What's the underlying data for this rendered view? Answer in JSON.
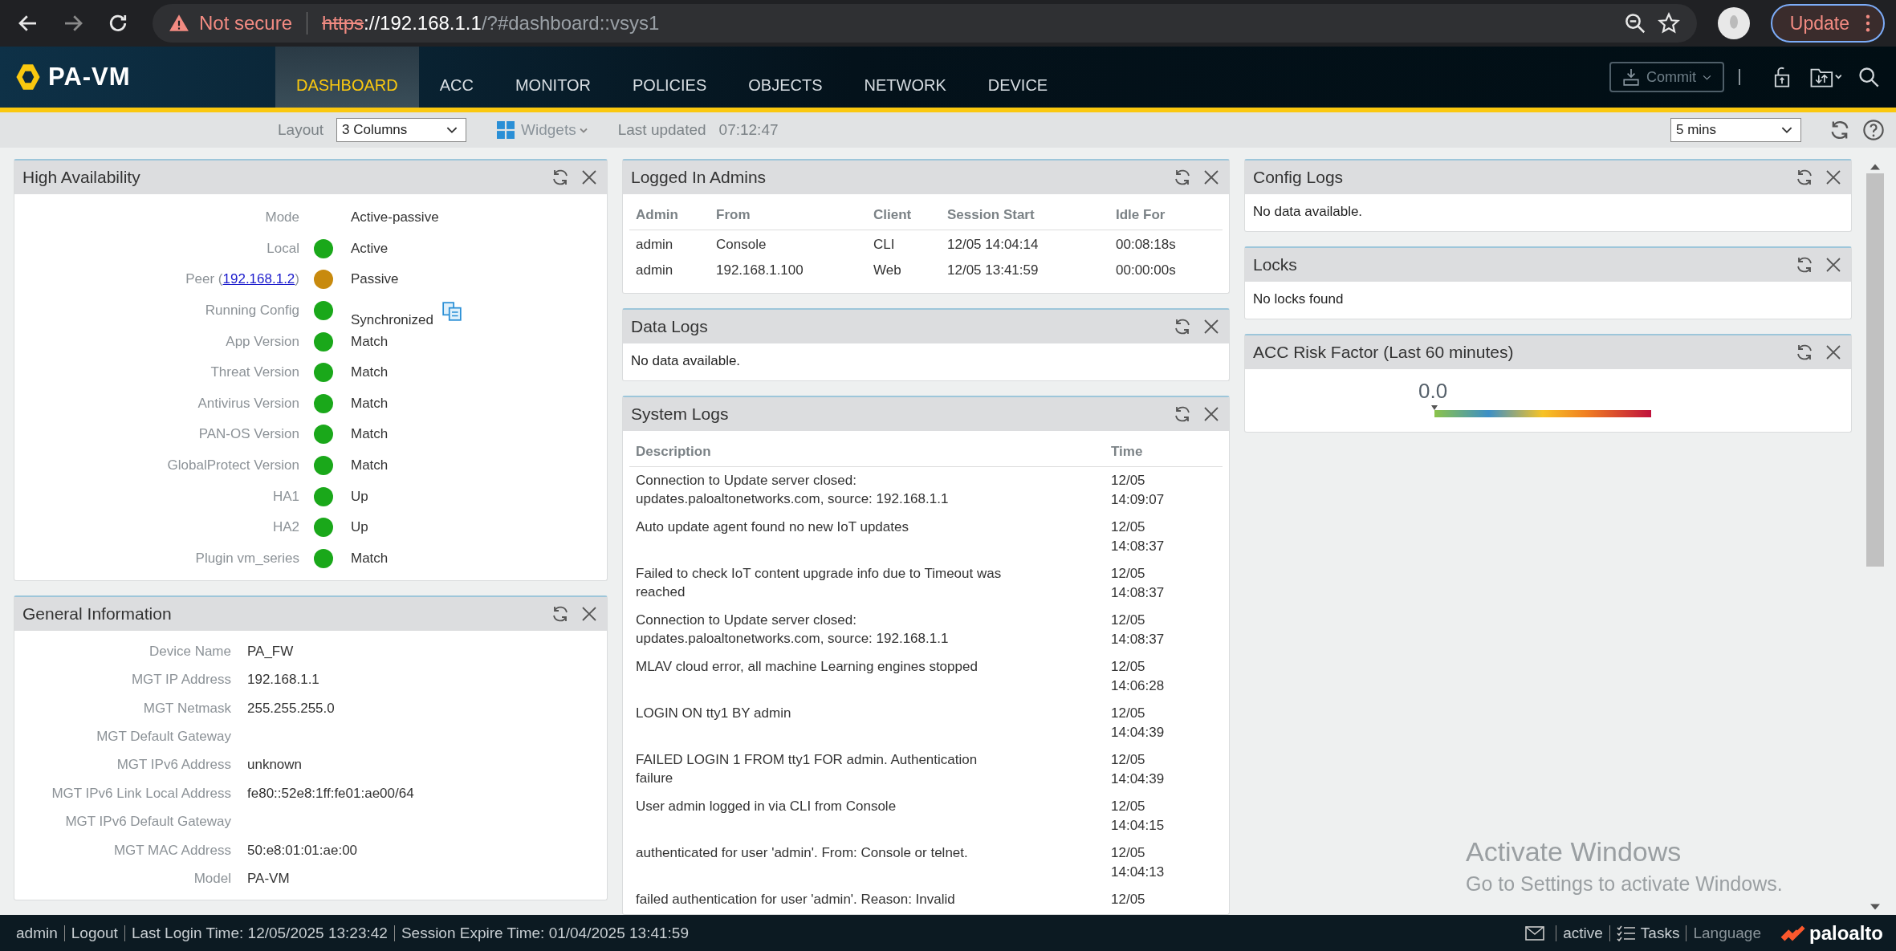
{
  "browser": {
    "security": "Not secure",
    "url_scheme": "https",
    "url_host": "://192.168.1.1",
    "url_path": "/?#dashboard::vsys1",
    "update": "Update"
  },
  "app": {
    "logo": "PA-VM",
    "tabs": [
      {
        "label": "DASHBOARD",
        "selected": true
      },
      {
        "label": "ACC",
        "selected": false
      },
      {
        "label": "MONITOR",
        "selected": false
      },
      {
        "label": "POLICIES",
        "selected": false
      },
      {
        "label": "OBJECTS",
        "selected": false
      },
      {
        "label": "NETWORK",
        "selected": false
      },
      {
        "label": "DEVICE",
        "selected": false
      }
    ],
    "commit": "Commit"
  },
  "toolbar": {
    "layout_label": "Layout",
    "layout_value": "3 Columns",
    "widgets": "Widgets",
    "updated_label": "Last updated",
    "updated_time": "07:12:47",
    "interval": "5 mins"
  },
  "high_availability": {
    "title": "High Availability",
    "rows": [
      {
        "label": "Mode",
        "value": "Active-passive",
        "sync_icon": false
      },
      {
        "label": "Local",
        "color": "#1aa81a",
        "value": "Active",
        "sync_icon": false
      },
      {
        "label": "Peer (",
        "link": "192.168.1.2",
        "label_end": ")",
        "color": "#c88a0e",
        "value": "Passive",
        "sync_icon": false
      },
      {
        "label": "Running Config",
        "color": "#1aa81a",
        "value": "Synchronized",
        "sync_icon": true
      },
      {
        "label": "App Version",
        "color": "#1aa81a",
        "value": "Match",
        "sync_icon": false
      },
      {
        "label": "Threat Version",
        "color": "#1aa81a",
        "value": "Match",
        "sync_icon": false
      },
      {
        "label": "Antivirus Version",
        "color": "#1aa81a",
        "value": "Match",
        "sync_icon": false
      },
      {
        "label": "PAN-OS Version",
        "color": "#1aa81a",
        "value": "Match",
        "sync_icon": false
      },
      {
        "label": "GlobalProtect Version",
        "color": "#1aa81a",
        "value": "Match",
        "sync_icon": false
      },
      {
        "label": "HA1",
        "color": "#1aa81a",
        "value": "Up",
        "sync_icon": false
      },
      {
        "label": "HA2",
        "color": "#1aa81a",
        "value": "Up",
        "sync_icon": false
      },
      {
        "label": "Plugin vm_series",
        "color": "#1aa81a",
        "value": "Match",
        "sync_icon": false
      }
    ]
  },
  "general_information": {
    "title": "General Information",
    "rows": [
      {
        "label": "Device Name",
        "value": "PA_FW"
      },
      {
        "label": "MGT IP Address",
        "value": "192.168.1.1"
      },
      {
        "label": "MGT Netmask",
        "value": "255.255.255.0"
      },
      {
        "label": "MGT Default Gateway"
      },
      {
        "label": "MGT IPv6 Address",
        "value": "unknown"
      },
      {
        "label": "MGT IPv6 Link Local Address",
        "value": "fe80::52e8:1ff:fe01:ae00/64"
      },
      {
        "label": "MGT IPv6 Default Gateway"
      },
      {
        "label": "MGT MAC Address",
        "value": "50:e8:01:01:ae:00"
      },
      {
        "label": "Model",
        "value": "PA-VM"
      }
    ]
  },
  "logged_in_admins": {
    "title": "Logged In Admins",
    "columns": [
      "Admin",
      "From",
      "Client",
      "Session Start",
      "Idle For"
    ],
    "rows": [
      [
        "admin",
        "Console",
        "CLI",
        "12/05 14:04:14",
        "00:08:18s"
      ],
      [
        "admin",
        "192.168.1.100",
        "Web",
        "12/05 13:41:59",
        "00:00:00s"
      ]
    ]
  },
  "data_logs": {
    "title": "Data Logs",
    "message": "No data available."
  },
  "system_logs": {
    "title": "System Logs",
    "columns": [
      "Description",
      "Time"
    ],
    "rows": [
      {
        "description": "Connection to Update server closed: updates.paloaltonetworks.com, source: 192.168.1.1",
        "date": "12/05",
        "time": "14:09:07"
      },
      {
        "description": "Auto update agent found no new IoT updates",
        "date": "12/05",
        "time": "14:08:37"
      },
      {
        "description": "Failed to check IoT content upgrade info due to Timeout was reached",
        "date": "12/05",
        "time": "14:08:37"
      },
      {
        "description": "Connection to Update server closed: updates.paloaltonetworks.com, source: 192.168.1.1",
        "date": "12/05",
        "time": "14:08:37"
      },
      {
        "description": "MLAV cloud error, all machine Learning engines stopped",
        "date": "12/05",
        "time": "14:06:28"
      },
      {
        "description": "LOGIN ON tty1 BY admin",
        "date": "12/05",
        "time": "14:04:39"
      },
      {
        "description": "FAILED LOGIN 1 FROM tty1 FOR admin. Authentication failure",
        "date": "12/05",
        "time": "14:04:39"
      },
      {
        "description": "User admin logged in via CLI from Console",
        "date": "12/05",
        "time": "14:04:15"
      },
      {
        "description": "authenticated for user 'admin'. From: Console or telnet.",
        "date": "12/05",
        "time": "14:04:13"
      },
      {
        "description": "failed authentication for user 'admin'. Reason: Invalid",
        "date": "12/05"
      }
    ]
  },
  "config_logs": {
    "title": "Config Logs",
    "message": "No data available."
  },
  "locks": {
    "title": "Locks",
    "message": "No locks found"
  },
  "acc_risk": {
    "title": "ACC Risk Factor (Last 60 minutes)",
    "value": "0.0",
    "level": 0
  },
  "windows_notice": {
    "title": "Activate Windows",
    "subtitle": "Go to Settings to activate Windows."
  },
  "status_bar": {
    "user": "admin",
    "logout": "Logout",
    "last_login": "Last Login Time: 12/05/2025 13:23:42",
    "session_expire": "Session Expire Time: 01/04/2025 13:41:59",
    "active": "active",
    "tasks": "Tasks",
    "language": "Language",
    "brand": "paloalto"
  }
}
